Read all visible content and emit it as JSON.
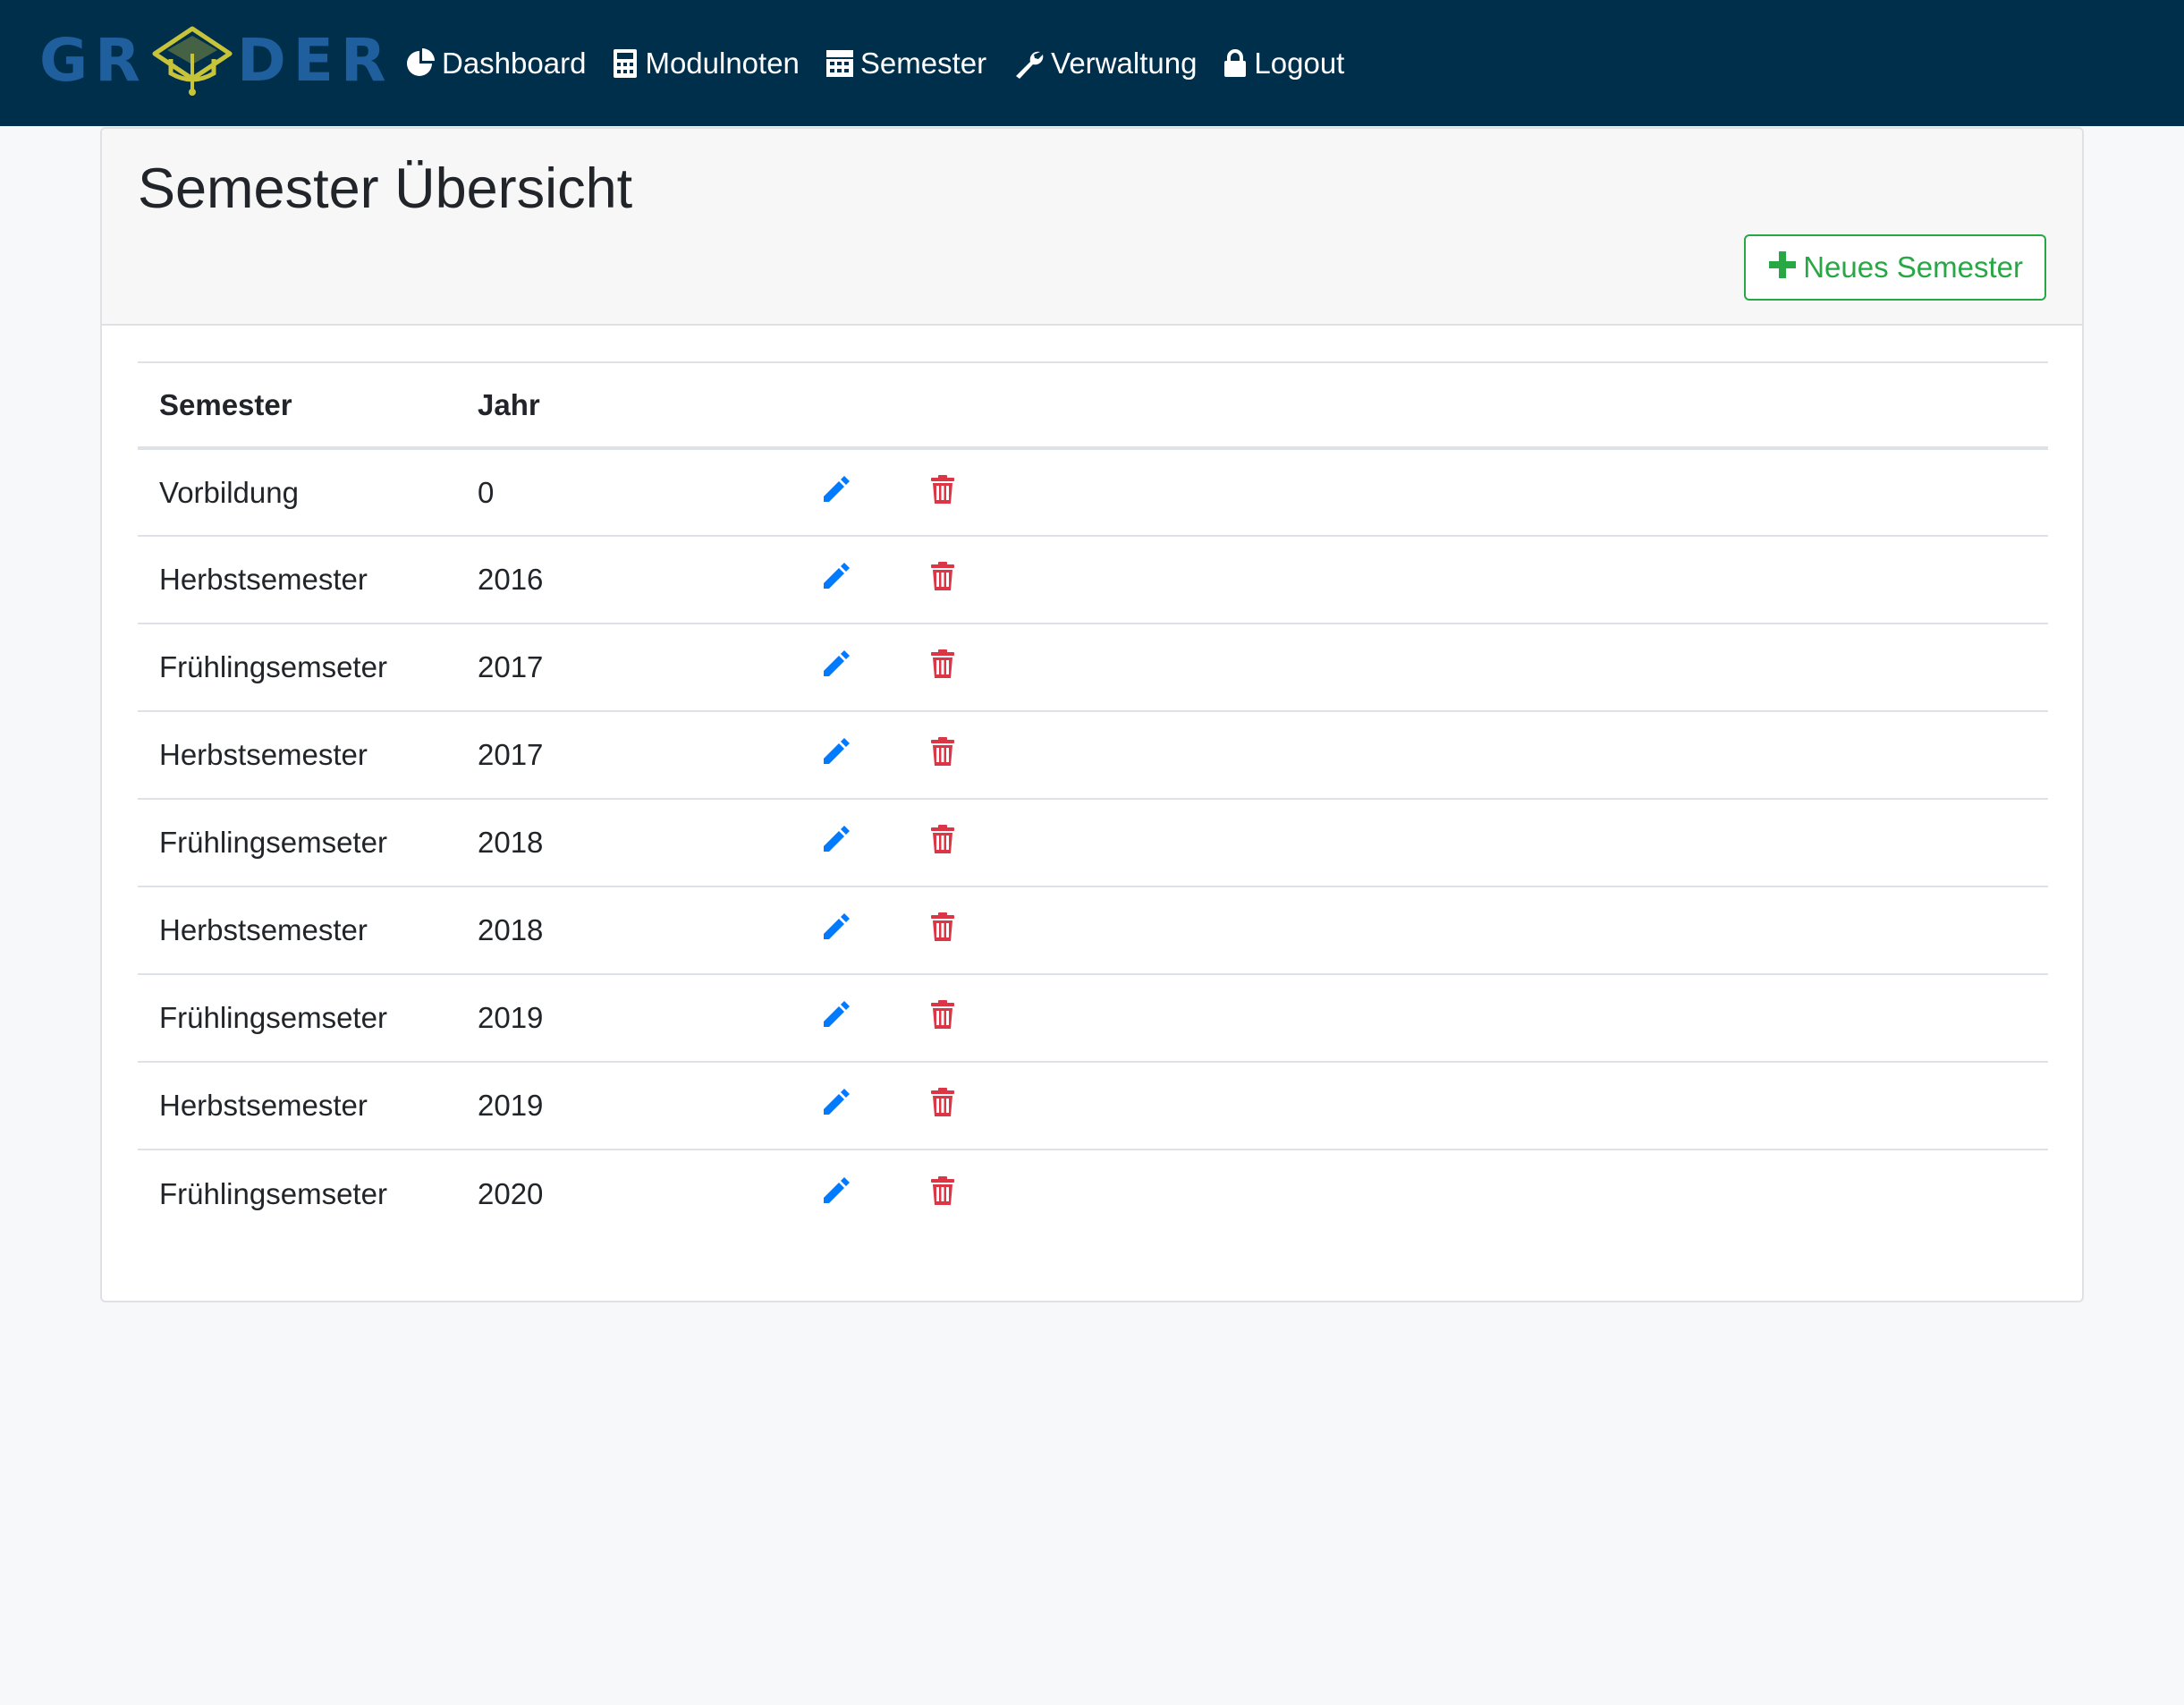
{
  "navbar": {
    "brand": {
      "left": "GR",
      "right": "DER",
      "colors": {
        "text": "#1f5f9e",
        "cap": "#c7c43a"
      }
    },
    "items": [
      {
        "label": "Dashboard",
        "icon": "pie-chart-icon"
      },
      {
        "label": "Modulnoten",
        "icon": "calculator-icon"
      },
      {
        "label": "Semester",
        "icon": "calendar-table-icon"
      },
      {
        "label": "Verwaltung",
        "icon": "wrench-icon"
      },
      {
        "label": "Logout",
        "icon": "lock-icon"
      }
    ],
    "background": "#002f4c"
  },
  "page": {
    "title": "Semester Übersicht",
    "new_button_label": "Neues Semester"
  },
  "table": {
    "headers": [
      "Semester",
      "Jahr",
      "",
      ""
    ],
    "rows": [
      {
        "semester": "Vorbildung",
        "year": "0"
      },
      {
        "semester": "Herbstsemester",
        "year": "2016"
      },
      {
        "semester": "Frühlingsemseter",
        "year": "2017"
      },
      {
        "semester": "Herbstsemester",
        "year": "2017"
      },
      {
        "semester": "Frühlingsemseter",
        "year": "2018"
      },
      {
        "semester": "Herbstsemester",
        "year": "2018"
      },
      {
        "semester": "Frühlingsemseter",
        "year": "2019"
      },
      {
        "semester": "Herbstsemester",
        "year": "2019"
      },
      {
        "semester": "Frühlingsemseter",
        "year": "2020"
      }
    ],
    "row_actions": {
      "edit_icon": "pencil-icon",
      "delete_icon": "trash-icon"
    }
  },
  "colors": {
    "accent_edit": "#007bff",
    "accent_delete": "#dc3545",
    "success": "#28a745"
  }
}
